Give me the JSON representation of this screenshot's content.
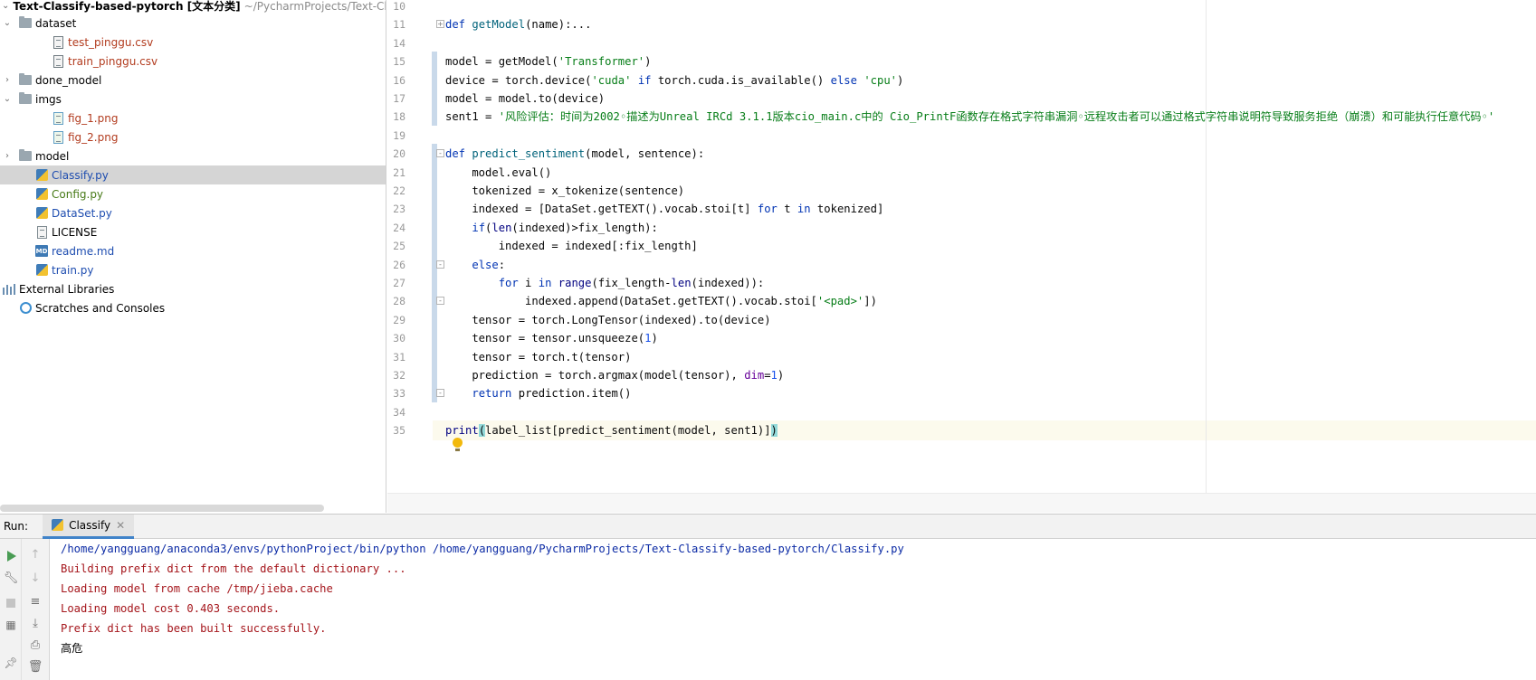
{
  "project_tree": {
    "project_name": "Text-Classify-based-pytorch [文本分类]",
    "project_path": "~/PycharmProjects/Text-Classify-",
    "items": [
      {
        "label": "dataset",
        "kind": "folder"
      },
      {
        "label": "test_pinggu.csv",
        "kind": "csv"
      },
      {
        "label": "train_pinggu.csv",
        "kind": "csv"
      },
      {
        "label": "done_model",
        "kind": "folder"
      },
      {
        "label": "imgs",
        "kind": "folder"
      },
      {
        "label": "fig_1.png",
        "kind": "png"
      },
      {
        "label": "fig_2.png",
        "kind": "png"
      },
      {
        "label": "model",
        "kind": "folder"
      },
      {
        "label": "Classify.py",
        "kind": "py",
        "selected": true
      },
      {
        "label": "Config.py",
        "kind": "py"
      },
      {
        "label": "DataSet.py",
        "kind": "py"
      },
      {
        "label": "LICENSE",
        "kind": "file"
      },
      {
        "label": "readme.md",
        "kind": "md"
      },
      {
        "label": "train.py",
        "kind": "py"
      },
      {
        "label": "External Libraries",
        "kind": "libraries"
      },
      {
        "label": "Scratches and Consoles",
        "kind": "scratches"
      }
    ]
  },
  "editor": {
    "current_line": 35,
    "lines": [
      {
        "n": "10",
        "text": ""
      },
      {
        "n": "11",
        "text": "def getModel(name):..."
      },
      {
        "n": "14",
        "text": ""
      },
      {
        "n": "15",
        "text": "model = getModel('Transformer')"
      },
      {
        "n": "16",
        "text": "device = torch.device('cuda' if torch.cuda.is_available() else 'cpu')"
      },
      {
        "n": "17",
        "text": "model = model.to(device)"
      },
      {
        "n": "18",
        "text": "sent1 = '风险评估：时间为2002◦描述为Unreal IRCd 3.1.1版本cio_main.c中的 Cio_PrintF函数存在格式字符串漏洞◦远程攻击者可以通过格式字符串说明符导致服务拒绝（崩溃）和可能执行任意代码◦'"
      },
      {
        "n": "19",
        "text": ""
      },
      {
        "n": "20",
        "text": "def predict_sentiment(model, sentence):"
      },
      {
        "n": "21",
        "text": "    model.eval()"
      },
      {
        "n": "22",
        "text": "    tokenized = x_tokenize(sentence)"
      },
      {
        "n": "23",
        "text": "    indexed = [DataSet.getTEXT().vocab.stoi[t] for t in tokenized]"
      },
      {
        "n": "24",
        "text": "    if(len(indexed)>fix_length):"
      },
      {
        "n": "25",
        "text": "        indexed = indexed[:fix_length]"
      },
      {
        "n": "26",
        "text": "    else:"
      },
      {
        "n": "27",
        "text": "        for i in range(fix_length-len(indexed)):"
      },
      {
        "n": "28",
        "text": "            indexed.append(DataSet.getTEXT().vocab.stoi['<pad>'])"
      },
      {
        "n": "29",
        "text": "    tensor = torch.LongTensor(indexed).to(device)"
      },
      {
        "n": "30",
        "text": "    tensor = tensor.unsqueeze(1)"
      },
      {
        "n": "31",
        "text": "    tensor = torch.t(tensor)"
      },
      {
        "n": "32",
        "text": "    prediction = torch.argmax(model(tensor), dim=1)"
      },
      {
        "n": "33",
        "text": "    return prediction.item()"
      },
      {
        "n": "34",
        "text": ""
      },
      {
        "n": "35",
        "text": "print(label_list[predict_sentiment(model, sent1)])"
      }
    ]
  },
  "run_panel": {
    "label": "Run:",
    "tab_label": "Classify",
    "console": [
      {
        "text": "/home/yangguang/anaconda3/envs/pythonProject/bin/python /home/yangguang/PycharmProjects/Text-Classify-based-pytorch/Classify.py",
        "kind": "cmd"
      },
      {
        "text": "Building prefix dict from the default dictionary ...",
        "kind": "err"
      },
      {
        "text": "Loading model from cache /tmp/jieba.cache",
        "kind": "err"
      },
      {
        "text": "Loading model cost 0.403 seconds.",
        "kind": "err"
      },
      {
        "text": "Prefix dict has been built successfully.",
        "kind": "err"
      },
      {
        "text": "高危",
        "kind": "out"
      }
    ]
  },
  "icons": {
    "folder": "folder-icon",
    "python_file": "python-file-icon",
    "run": "run-icon",
    "stop": "stop-icon",
    "intention": "lightbulb-icon"
  },
  "colors": {
    "keyword": "#0033b3",
    "string": "#067d17",
    "number": "#1750eb",
    "function_name": "#00627a",
    "console_error": "#a5161c",
    "console_command": "#0c2ba5",
    "selection": "#d5d5d5",
    "active_tab_underline": "#4083c9"
  }
}
